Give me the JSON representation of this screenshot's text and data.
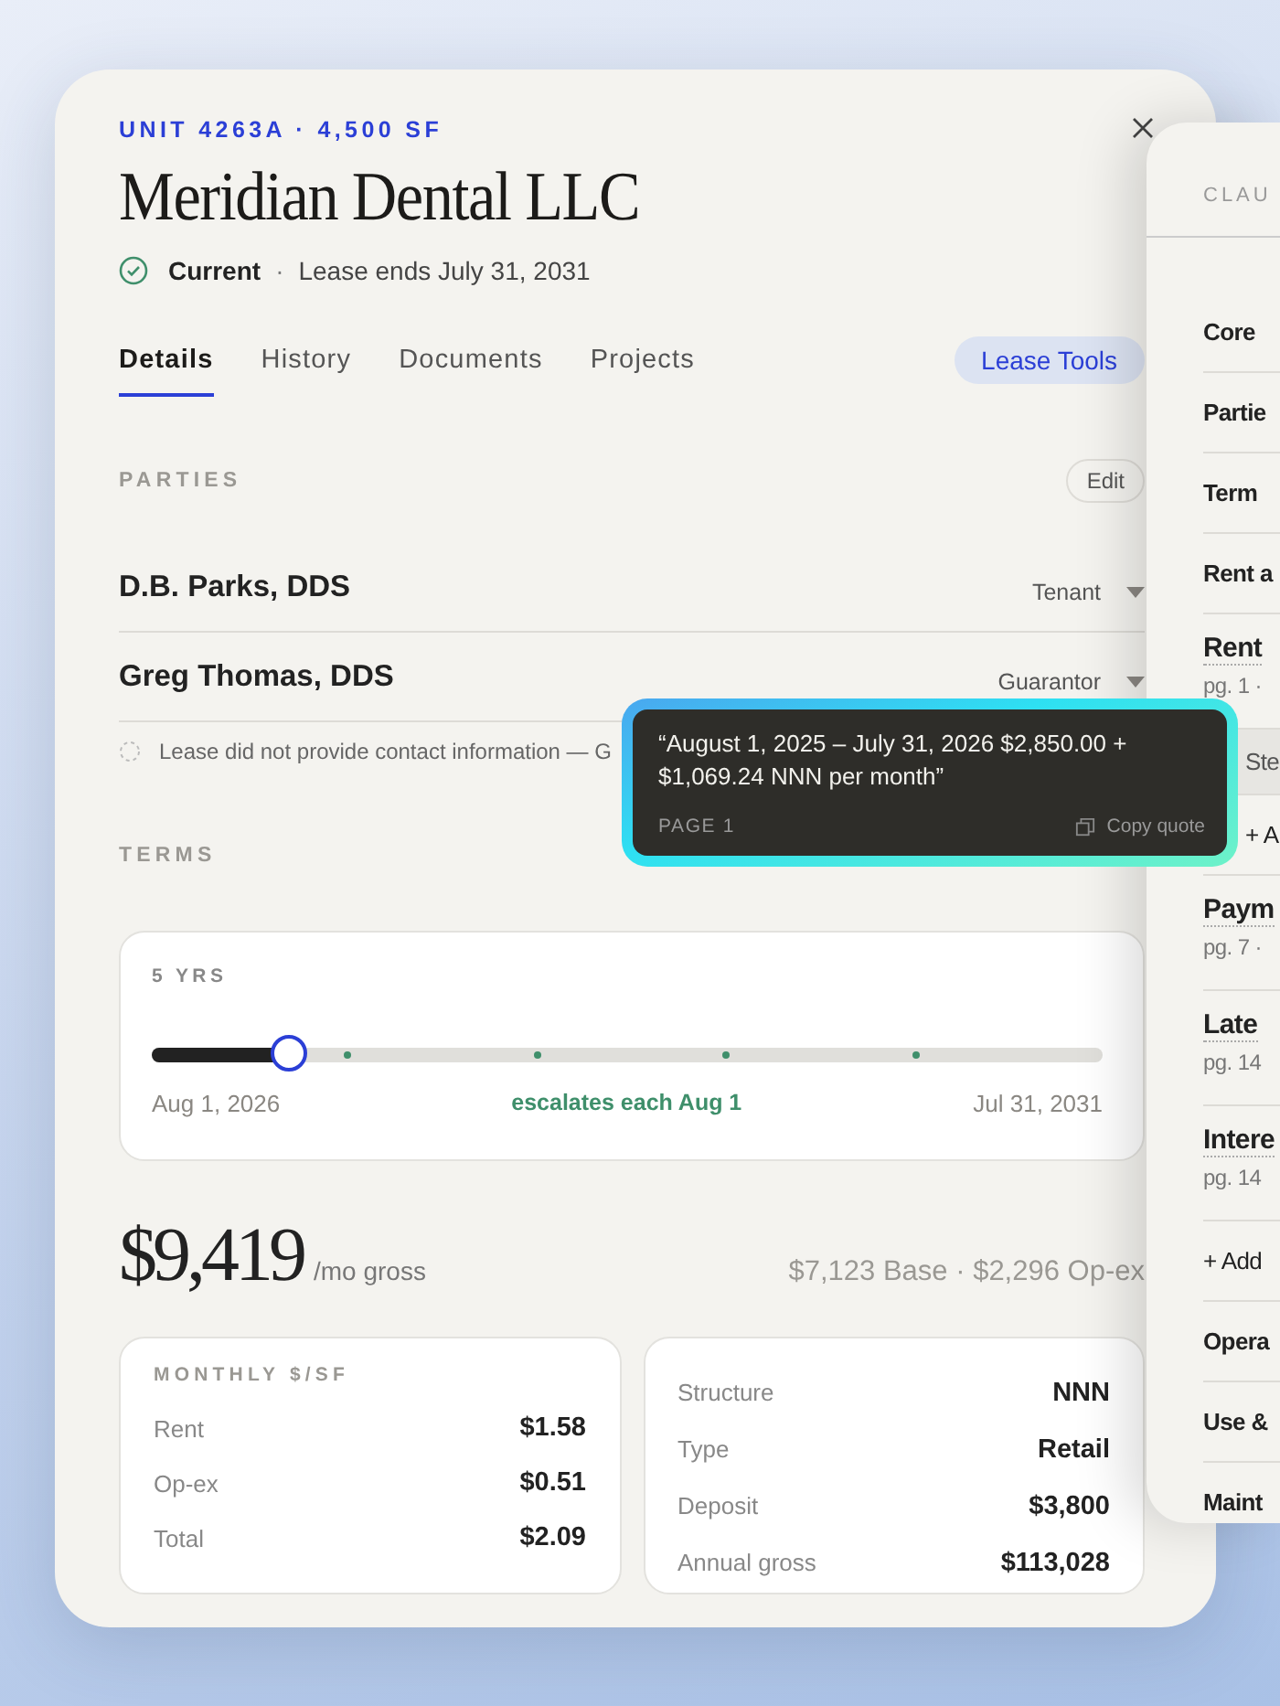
{
  "header": {
    "unit": "UNIT 4263A · 4,500 SF",
    "title": "Meridian Dental LLC",
    "status": "Current",
    "separator": "·",
    "lease_end": "Lease ends July 31, 2031"
  },
  "tabs": [
    {
      "label": "Details",
      "selected": true
    },
    {
      "label": "History",
      "selected": false
    },
    {
      "label": "Documents",
      "selected": false
    },
    {
      "label": "Projects",
      "selected": false
    }
  ],
  "lease_tools_button": "Lease Tools",
  "parties": {
    "heading": "PARTIES",
    "edit_button": "Edit",
    "rows": [
      {
        "name": "D.B. Parks, DDS",
        "role": "Tenant"
      },
      {
        "name": "Greg Thomas, DDS",
        "role": "Guarantor"
      }
    ],
    "note": "Lease did not provide contact information — G"
  },
  "terms": {
    "heading": "TERMS",
    "duration": "5 YRS",
    "level": 0.145,
    "start": "Aug 1, 2026",
    "escalation": "escalates each Aug 1",
    "end": "Jul 31, 2031"
  },
  "rent": {
    "amount": "$9,419",
    "unit": "/mo gross",
    "breakdown": "$7,123 Base · $2,296 Op-ex"
  },
  "monthly_psf": {
    "heading": "MONTHLY $/SF",
    "rows": [
      {
        "label": "Rent",
        "value": "$1.58"
      },
      {
        "label": "Op-ex",
        "value": "$0.51"
      },
      {
        "label": "Total",
        "value": "$2.09"
      }
    ]
  },
  "facts": [
    {
      "label": "Structure",
      "value": "NNN"
    },
    {
      "label": "Type",
      "value": "Retail"
    },
    {
      "label": "Deposit",
      "value": "$3,800"
    },
    {
      "label": "Annual gross",
      "value": "$113,028"
    }
  ],
  "tooltip": {
    "quote": "“August 1, 2025 – July 31, 2026 $2,850.00 + $1,069.24 NNN per month”",
    "page": "PAGE 1",
    "copy": "Copy quote"
  },
  "clauses": {
    "heading": "CLAU",
    "items": [
      {
        "kind": "item",
        "title": "Core"
      },
      {
        "kind": "item",
        "title": "Partie"
      },
      {
        "kind": "item",
        "title": "Term"
      },
      {
        "kind": "item",
        "title": "Rent a"
      },
      {
        "kind": "cited",
        "title": "Rent",
        "sub": "pg. 1 ·"
      },
      {
        "kind": "highlight",
        "title": "Ste"
      },
      {
        "kind": "subadd",
        "title": "+ A"
      },
      {
        "kind": "cited",
        "title": "Paym",
        "sub": "pg. 7 ·"
      },
      {
        "kind": "cited",
        "title": "Late",
        "sub": "pg. 14"
      },
      {
        "kind": "cited",
        "title": "Intere",
        "sub": "pg. 14"
      },
      {
        "kind": "add",
        "title": "+ Add"
      },
      {
        "kind": "item",
        "title": "Opera"
      },
      {
        "kind": "item",
        "title": "Use &"
      },
      {
        "kind": "item",
        "title": "Maint"
      }
    ]
  }
}
